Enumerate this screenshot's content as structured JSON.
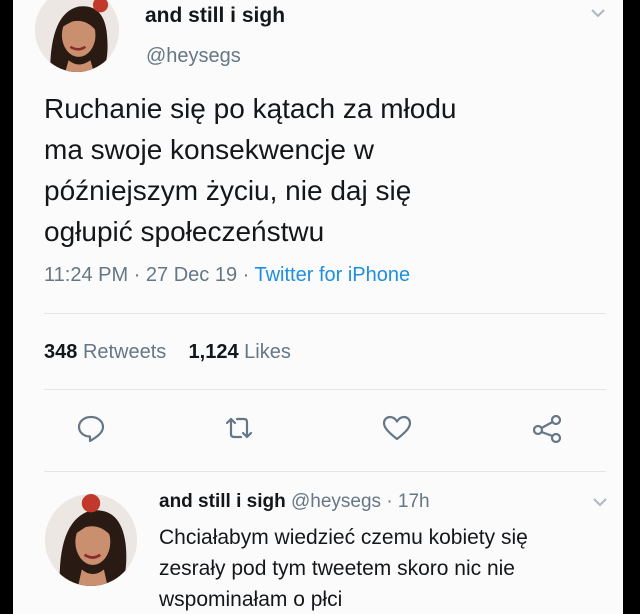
{
  "tweet": {
    "author_name": "and still i sigh",
    "author_handle": "@heysegs",
    "text_lines": [
      "Ruchanie się po kątach za młodu",
      "ma swoje konsekwencje w",
      "późniejszym życiu, nie daj się",
      "ogłupić społeczeństwu"
    ],
    "time": "11:24 PM",
    "date": "27 Dec 19",
    "source": "Twitter for iPhone",
    "retweets_count": "348",
    "retweets_label": "Retweets",
    "likes_count": "1,124",
    "likes_label": "Likes"
  },
  "actions": [
    "reply-icon",
    "retweet-icon",
    "like-icon",
    "share-icon"
  ],
  "reply": {
    "author_name": "and still i sigh",
    "author_handle": "@heysegs",
    "age": "17h",
    "text_lines": [
      "Chciałabym wiedzieć czemu kobiety się",
      "zesrały pod tym tweetem skoro nic nie",
      "wspominałam o płci"
    ]
  },
  "colors": {
    "text": "#14171a",
    "secondary": "#657786",
    "link": "#1d8fe0",
    "background": "#fbfbfb"
  }
}
